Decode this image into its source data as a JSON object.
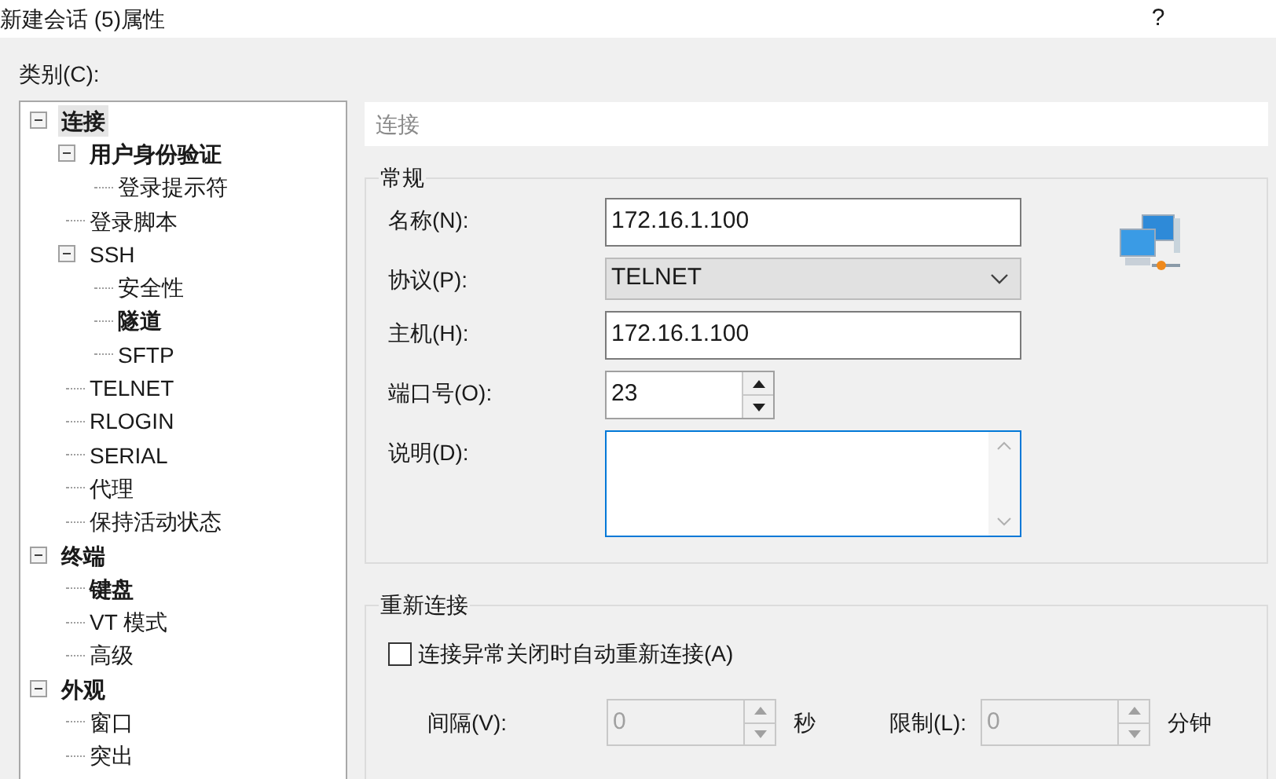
{
  "window": {
    "title": "新建会话 (5)属性",
    "help": "?"
  },
  "category_label": "类别(C):",
  "tree": [
    {
      "label": "连接",
      "bold": true,
      "selected": true,
      "expanded": true,
      "children": [
        {
          "label": "用户身份验证",
          "bold": true,
          "selected": false,
          "expanded": true,
          "children": [
            {
              "label": "登录提示符",
              "bold": false,
              "selected": false
            }
          ]
        },
        {
          "label": "登录脚本",
          "bold": false,
          "selected": false
        },
        {
          "label": "SSH",
          "bold": false,
          "selected": false,
          "expanded": true,
          "children": [
            {
              "label": "安全性",
              "bold": false,
              "selected": false
            },
            {
              "label": "隧道",
              "bold": true,
              "selected": false
            },
            {
              "label": "SFTP",
              "bold": false,
              "selected": false
            }
          ]
        },
        {
          "label": "TELNET",
          "bold": false,
          "selected": false
        },
        {
          "label": "RLOGIN",
          "bold": false,
          "selected": false
        },
        {
          "label": "SERIAL",
          "bold": false,
          "selected": false
        },
        {
          "label": "代理",
          "bold": false,
          "selected": false
        },
        {
          "label": "保持活动状态",
          "bold": false,
          "selected": false
        }
      ]
    },
    {
      "label": "终端",
      "bold": true,
      "selected": false,
      "expanded": true,
      "children": [
        {
          "label": "键盘",
          "bold": true,
          "selected": false
        },
        {
          "label": "VT 模式",
          "bold": false,
          "selected": false
        },
        {
          "label": "高级",
          "bold": false,
          "selected": false
        }
      ]
    },
    {
      "label": "外观",
      "bold": true,
      "selected": false,
      "expanded": true,
      "children": [
        {
          "label": "窗口",
          "bold": false,
          "selected": false
        },
        {
          "label": "突出",
          "bold": false,
          "selected": false
        }
      ]
    }
  ],
  "page_title": "连接",
  "general": {
    "title": "常规",
    "fields": [
      {
        "kind": "text",
        "label": "名称(N):",
        "value": "172.16.1.100"
      },
      {
        "kind": "select",
        "label": "协议(P):",
        "value": "TELNET"
      },
      {
        "kind": "text",
        "label": "主机(H):",
        "value": "172.16.1.100"
      },
      {
        "kind": "spin",
        "label": "端口号(O):",
        "value": "23"
      },
      {
        "kind": "textarea",
        "label": "说明(D):",
        "focused": true
      }
    ]
  },
  "reconnect": {
    "title": "重新连接",
    "checkbox": {
      "label": "连接异常关闭时自动重新连接(A)",
      "checked": false
    },
    "spins": [
      {
        "label": "间隔(V):",
        "value": "0",
        "unit": "秒",
        "disabled": true
      },
      {
        "label": "限制(L):",
        "value": "0",
        "unit": "分钟",
        "disabled": true
      }
    ]
  }
}
